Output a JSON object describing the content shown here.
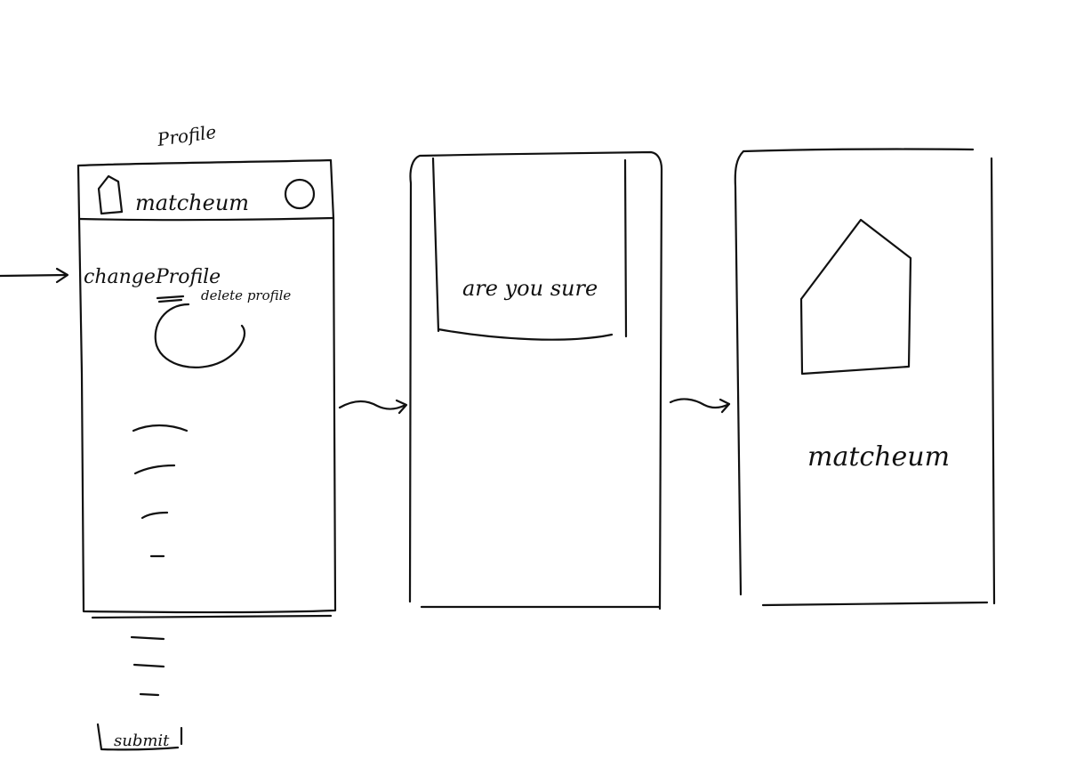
{
  "screens": {
    "profile": {
      "title": "Profile",
      "app_name": "matcheum",
      "change_profile_label": "changeProfile",
      "delete_profile_label": "delete profile",
      "submit_label": "submit"
    },
    "confirm": {
      "dialog_text": "are you sure"
    },
    "home": {
      "app_name": "matcheum",
      "logo_icon": "house-icon"
    }
  },
  "colors": {
    "ink": "#111111",
    "paper": "#ffffff"
  }
}
